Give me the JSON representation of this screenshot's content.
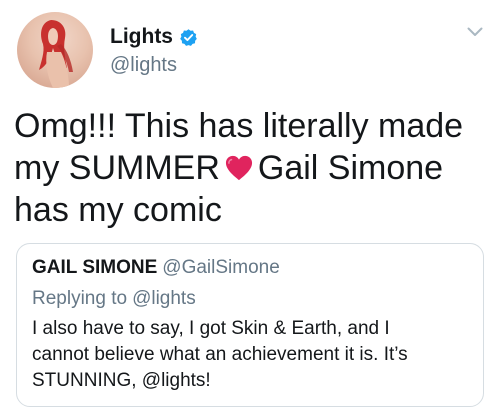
{
  "author": {
    "display_name": "Lights",
    "handle": "@lights",
    "verified": true,
    "avatar": "profile-photo"
  },
  "tweet": {
    "lines": [
      "Omg!!! This has literally made",
      "my SUMMER",
      "Gail Simone",
      "has my comic"
    ],
    "emoji": "red-heart-icon"
  },
  "quoted_tweet": {
    "display_name": "GAIL SIMONE",
    "handle": "@GailSimone",
    "replying_label": "Replying to",
    "replying_handle": "@lights",
    "text_lines": [
      "I also have to say, I got Skin & Earth, and I",
      "cannot believe what an achievement it is. It’s",
      "STUNNING, @lights!"
    ]
  },
  "colors": {
    "primary_text": "#14171a",
    "secondary_text": "#657786",
    "verified_blue": "#1da1f2",
    "heart_red": "#e0245e",
    "border": "#d6dde2"
  }
}
